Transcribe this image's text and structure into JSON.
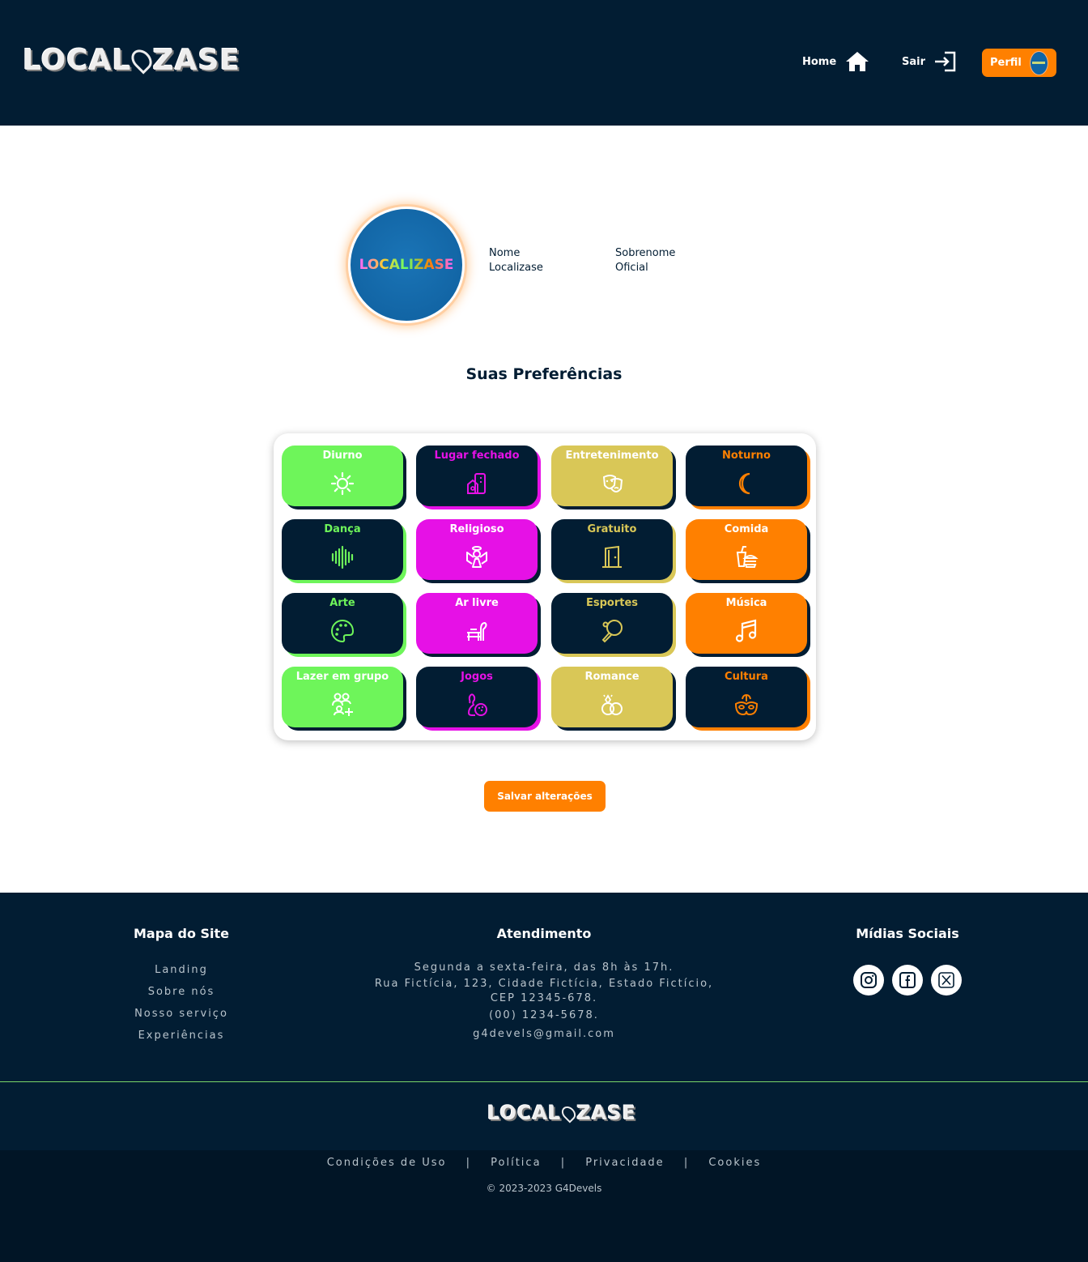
{
  "brand": {
    "name_left": "LOCAL",
    "name_right": "ZASE"
  },
  "nav": {
    "home_label": "Home",
    "sair_label": "Sair",
    "perfil_label": "Perfil"
  },
  "profile": {
    "nome_label": "Nome",
    "nome_value": "Localizase",
    "sobrenome_label": "Sobrenome",
    "sobrenome_value": "Oficial",
    "avatar_text": "LOCALIZASE"
  },
  "preferences": {
    "title": "Suas Preferências",
    "items": [
      {
        "label": "Diurno",
        "icon": "sun-icon",
        "bg": "#6ef55a",
        "fg": "#ffffff",
        "shadow": "#021d33"
      },
      {
        "label": "Lugar fechado",
        "icon": "building-icon",
        "bg": "#021d33",
        "fg": "#e611e6",
        "shadow": "#e611e6"
      },
      {
        "label": "Entretenimento",
        "icon": "theater-masks-icon",
        "bg": "#d9c757",
        "fg": "#ffffff",
        "shadow": "#021d33"
      },
      {
        "label": "Noturno",
        "icon": "moon-icon",
        "bg": "#021d33",
        "fg": "#ff8000",
        "shadow": "#ff8000"
      },
      {
        "label": "Dança",
        "icon": "soundwave-icon",
        "bg": "#021d33",
        "fg": "#6ef55a",
        "shadow": "#6ef55a"
      },
      {
        "label": "Religioso",
        "icon": "angel-icon",
        "bg": "#e611e6",
        "fg": "#ffffff",
        "shadow": "#021d33"
      },
      {
        "label": "Gratuito",
        "icon": "door-icon",
        "bg": "#021d33",
        "fg": "#d9c757",
        "shadow": "#d9c757"
      },
      {
        "label": "Comida",
        "icon": "fastfood-icon",
        "bg": "#ff8000",
        "fg": "#ffffff",
        "shadow": "#021d33"
      },
      {
        "label": "Arte",
        "icon": "palette-icon",
        "bg": "#021d33",
        "fg": "#6ef55a",
        "shadow": "#6ef55a"
      },
      {
        "label": "Ar livre",
        "icon": "bench-icon",
        "bg": "#e611e6",
        "fg": "#ffffff",
        "shadow": "#021d33"
      },
      {
        "label": "Esportes",
        "icon": "ping-pong-icon",
        "bg": "#021d33",
        "fg": "#d9c757",
        "shadow": "#d9c757"
      },
      {
        "label": "Música",
        "icon": "music-note-icon",
        "bg": "#ff8000",
        "fg": "#ffffff",
        "shadow": "#021d33"
      },
      {
        "label": "Lazer em grupo",
        "icon": "group-add-icon",
        "bg": "#6ef55a",
        "fg": "#ffffff",
        "shadow": "#021d33"
      },
      {
        "label": "Jogos",
        "icon": "bowling-icon",
        "bg": "#021d33",
        "fg": "#e611e6",
        "shadow": "#e611e6"
      },
      {
        "label": "Romance",
        "icon": "rings-icon",
        "bg": "#d9c757",
        "fg": "#ffffff",
        "shadow": "#021d33"
      },
      {
        "label": "Cultura",
        "icon": "carnival-mask-icon",
        "bg": "#021d33",
        "fg": "#ff8000",
        "shadow": "#ff8000"
      }
    ]
  },
  "save_label": "Salvar alterações",
  "footer": {
    "sitemap_title": "Mapa do Site",
    "sitemap_links": [
      "Landing",
      "Sobre nós",
      "Nosso serviço",
      "Experiências"
    ],
    "support_title": "Atendimento",
    "support_hours": "Segunda a sexta-feira, das 8h às 17h.",
    "support_address_1": "Rua Fictícia, 123, Cidade Fictícia, Estado Fictício,",
    "support_address_2": "CEP 12345-678.",
    "support_phone": "(00) 1234-5678.",
    "support_email": "g4devels@gmail.com",
    "social_title": "Mídias Sociais",
    "social_icons": [
      "instagram-icon",
      "facebook-icon",
      "x-twitter-icon"
    ],
    "legal_links": [
      "Condições de Uso",
      "Política",
      "Privacidade",
      "Cookies"
    ],
    "legal_separator": "|",
    "copyright": "© 2023-2023 G4Devels"
  },
  "colors": {
    "navy": "#021d33",
    "orange": "#ff8000",
    "green": "#6ef55a",
    "magenta": "#e611e6",
    "gold": "#d9c757"
  }
}
